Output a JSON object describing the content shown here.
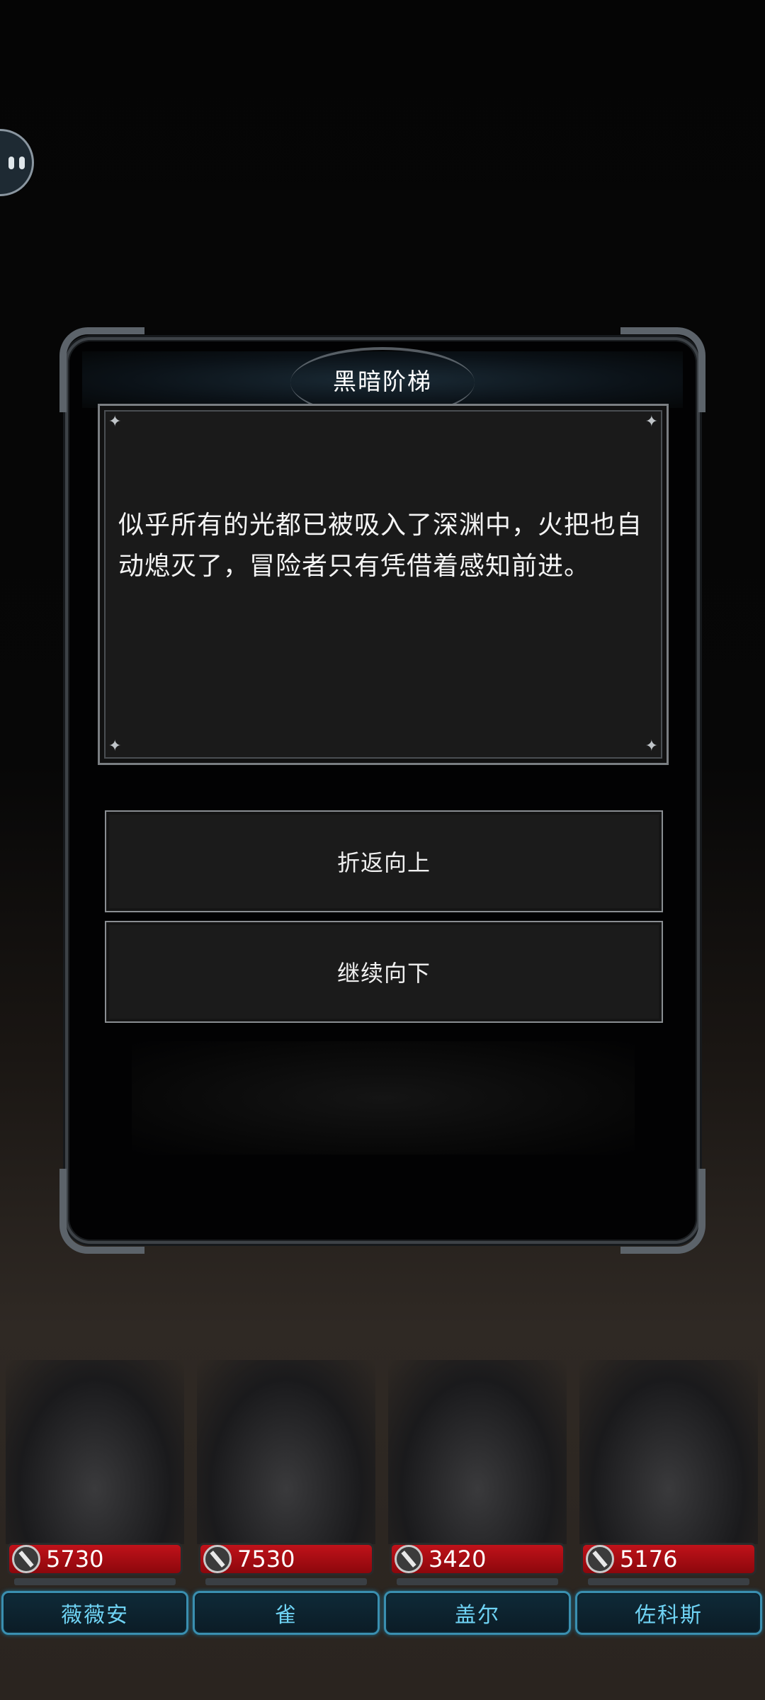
{
  "event": {
    "title": "黑暗阶梯",
    "description": "似乎所有的光都已被吸入了深渊中，火把也自动熄灭了，冒险者只有凭借着感知前进。",
    "choices": [
      {
        "label": "折返向上"
      },
      {
        "label": "继续向下"
      }
    ]
  },
  "party": [
    {
      "name": "薇薇安",
      "hp": "5730"
    },
    {
      "name": "雀",
      "hp": "7530"
    },
    {
      "name": "盖尔",
      "hp": "3420"
    },
    {
      "name": "佐科斯",
      "hp": "5176"
    }
  ],
  "colors": {
    "hp_bar": "#c0121a",
    "name_tag_border": "#3a8fb0",
    "name_text": "#6fd3f4"
  },
  "icons": {
    "float_button": "pause-bubble-icon",
    "hp": "sword-icon"
  }
}
